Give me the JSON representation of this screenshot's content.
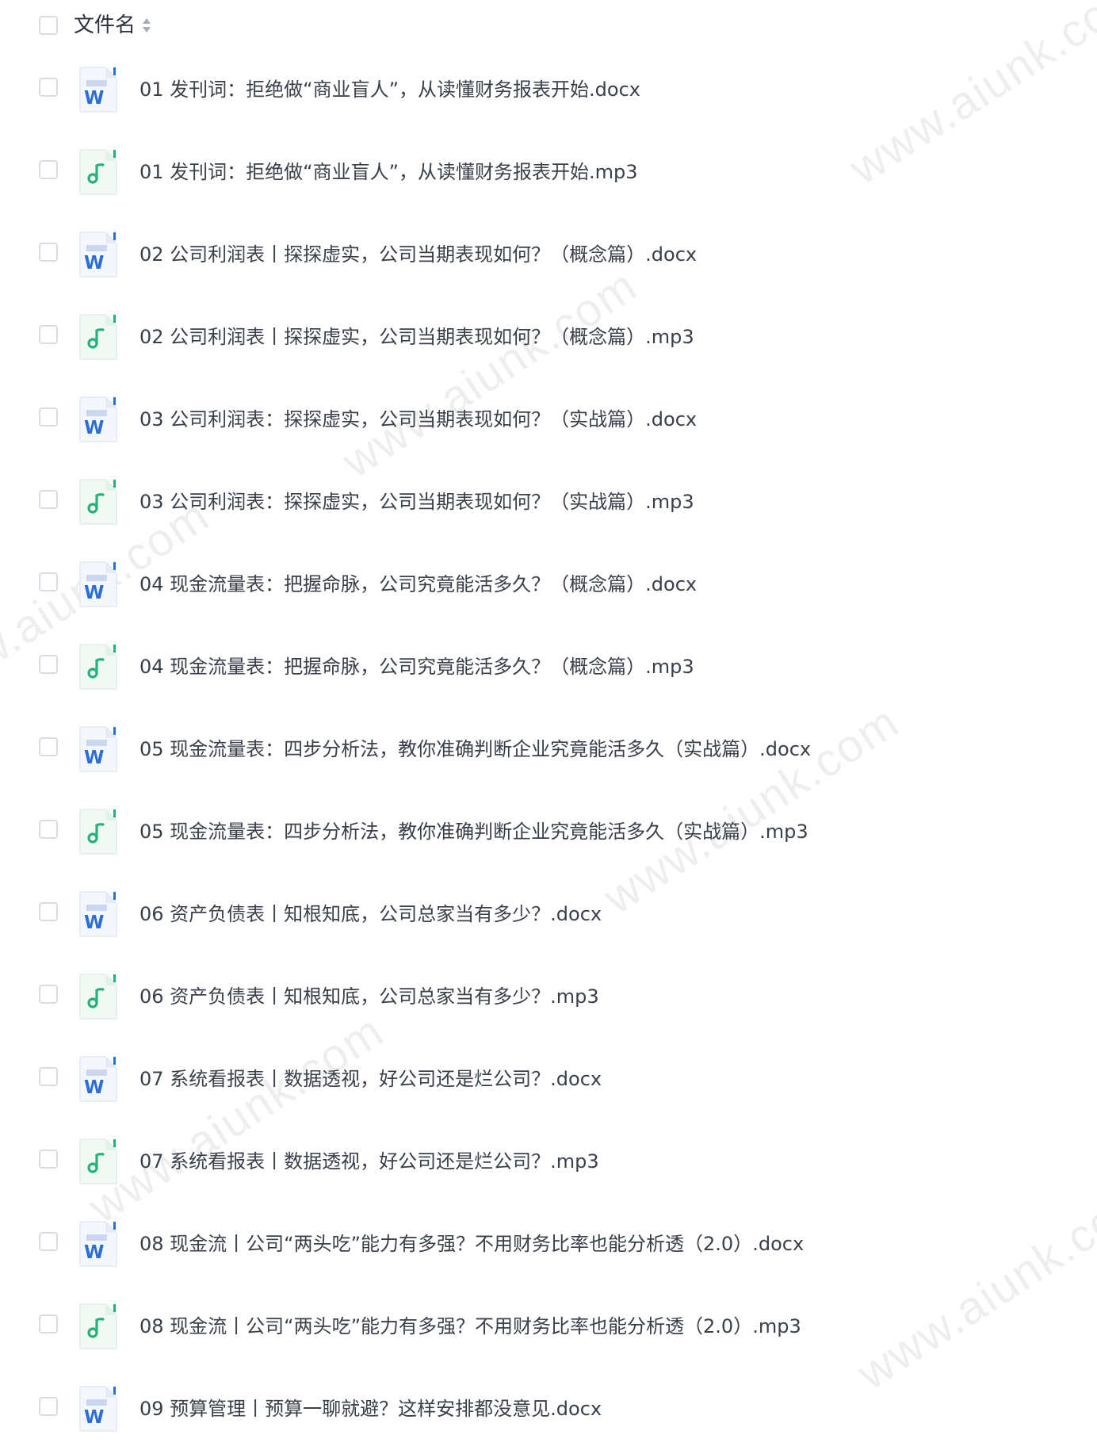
{
  "header": {
    "column_label": "文件名",
    "sort_icon": "sort-icon"
  },
  "files": [
    {
      "name": "01 发刊词：拒绝做“商业盲人”，从读懂财务报表开始.docx",
      "type": "docx",
      "icon": "word-file-icon"
    },
    {
      "name": "01 发刊词：拒绝做“商业盲人”，从读懂财务报表开始.mp3",
      "type": "mp3",
      "icon": "audio-file-icon"
    },
    {
      "name": "02 公司利润表丨探探虚实，公司当期表现如何？（概念篇）.docx",
      "type": "docx",
      "icon": "word-file-icon"
    },
    {
      "name": "02 公司利润表丨探探虚实，公司当期表现如何？（概念篇）.mp3",
      "type": "mp3",
      "icon": "audio-file-icon"
    },
    {
      "name": "03 公司利润表：探探虚实，公司当期表现如何？（实战篇）.docx",
      "type": "docx",
      "icon": "word-file-icon"
    },
    {
      "name": "03 公司利润表：探探虚实，公司当期表现如何？（实战篇）.mp3",
      "type": "mp3",
      "icon": "audio-file-icon"
    },
    {
      "name": "04 现金流量表：把握命脉，公司究竟能活多久？（概念篇）.docx",
      "type": "docx",
      "icon": "word-file-icon"
    },
    {
      "name": "04 现金流量表：把握命脉，公司究竟能活多久？（概念篇）.mp3",
      "type": "mp3",
      "icon": "audio-file-icon"
    },
    {
      "name": "05 现金流量表：四步分析法，教你准确判断企业究竟能活多久（实战篇）.docx",
      "type": "docx",
      "icon": "word-file-icon"
    },
    {
      "name": "05 现金流量表：四步分析法，教你准确判断企业究竟能活多久（实战篇）.mp3",
      "type": "mp3",
      "icon": "audio-file-icon"
    },
    {
      "name": "06 资产负债表丨知根知底，公司总家当有多少？.docx",
      "type": "docx",
      "icon": "word-file-icon"
    },
    {
      "name": "06 资产负债表丨知根知底，公司总家当有多少？.mp3",
      "type": "mp3",
      "icon": "audio-file-icon"
    },
    {
      "name": "07 系统看报表丨数据透视，好公司还是烂公司？.docx",
      "type": "docx",
      "icon": "word-file-icon"
    },
    {
      "name": "07 系统看报表丨数据透视，好公司还是烂公司？.mp3",
      "type": "mp3",
      "icon": "audio-file-icon"
    },
    {
      "name": "08 现金流丨公司“两头吃”能力有多强？不用财务比率也能分析透（2.0）.docx",
      "type": "docx",
      "icon": "word-file-icon"
    },
    {
      "name": "08 现金流丨公司“两头吃”能力有多强？不用财务比率也能分析透（2.0）.mp3",
      "type": "mp3",
      "icon": "audio-file-icon"
    },
    {
      "name": "09 预算管理丨预算一聊就避？这样安排都没意见.docx",
      "type": "docx",
      "icon": "word-file-icon"
    }
  ],
  "watermark": "www.aiunk.com",
  "colors": {
    "word_blue": "#2b6fd6",
    "audio_green": "#22b37a",
    "checkbox_border": "#d9dde3"
  }
}
